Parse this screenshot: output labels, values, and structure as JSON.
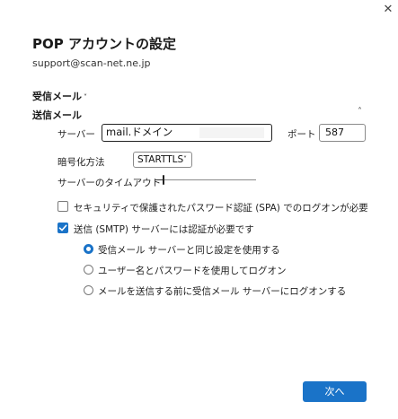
{
  "window": {
    "close_glyph": "✕"
  },
  "header": {
    "title": "POP アカウントの設定",
    "email": "support@scan-net.ne.jp"
  },
  "sections": {
    "incoming": {
      "label": "受信メール",
      "chevron": "˅"
    },
    "outgoing": {
      "label": "送信メール",
      "collapse_glyph": "˄"
    }
  },
  "outgoing": {
    "server_label": "サーバー",
    "server_value": "mail.ドメイン",
    "port_label": "ポート",
    "port_value": "587",
    "encryption_label": "暗号化方法",
    "encryption_value": "STARTTLS",
    "encryption_chevron": "˅",
    "timeout_label": "サーバーのタイムアウト",
    "timeout_level": 0.08,
    "spa_label": "セキュリティで保護されたパスワード認証 (SPA) でのログオンが必要",
    "spa_checked": false,
    "smtp_auth_label": "送信 (SMTP) サーバーには認証が必要です",
    "smtp_auth_checked": true,
    "auth_options": [
      {
        "label": "受信メール サーバーと同じ設定を使用する",
        "selected": true
      },
      {
        "label": "ユーザー名とパスワードを使用してログオン",
        "selected": false
      },
      {
        "label": "メールを送信する前に受信メール サーバーにログオンする",
        "selected": false
      }
    ]
  },
  "footer": {
    "next_label": "次へ"
  },
  "colors": {
    "accent": "#1a73c8",
    "text": "#1f1f1f",
    "background": "#ffffff"
  },
  "icons": {
    "close": "close-icon",
    "incoming_chevron": "chevron-down-icon",
    "outgoing_chevron": "chevron-up-icon",
    "select_chevron": "chevron-down-icon",
    "checkmark": "checkmark-icon"
  }
}
